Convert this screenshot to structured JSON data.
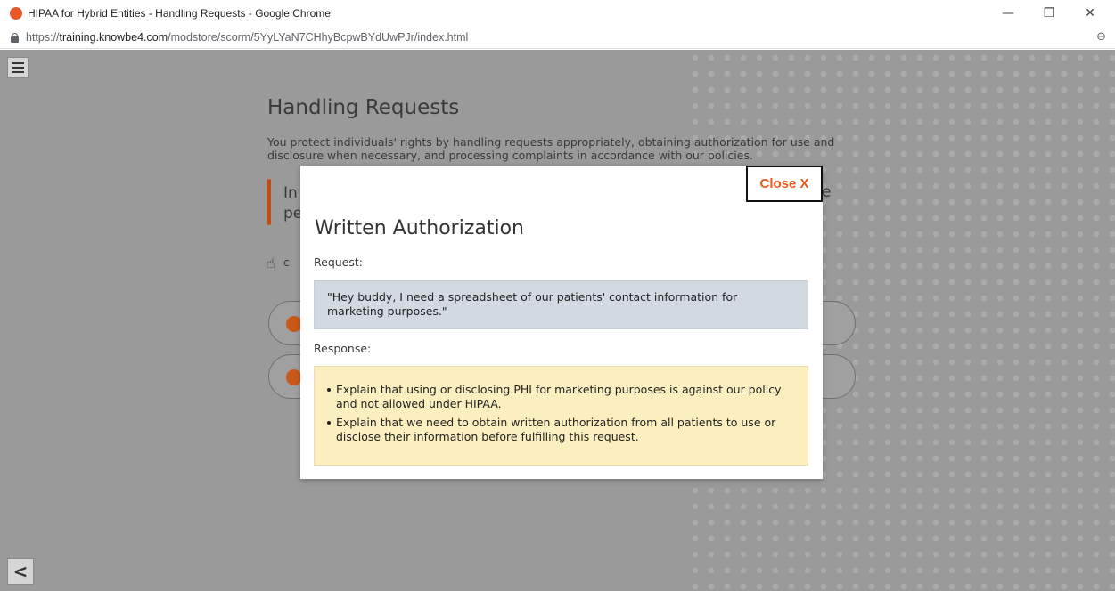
{
  "window": {
    "title": "HIPAA for Hybrid Entities - Handling Requests - Google Chrome",
    "controls": {
      "minimize": "—",
      "restore": "❐",
      "close": "✕"
    }
  },
  "address_bar": {
    "protocol": "https://",
    "host": "training.knowbe4.com",
    "path": "/modstore/scorm/5YyLYaN7CHhyBcpwBYdUwPJr/index.html",
    "zoom_icon": "⊖"
  },
  "background": {
    "heading": "Handling Requests",
    "intro": "You protect individuals' rights by handling requests appropriately, obtaining authorization for use and disclosure when necessary, and processing complaints in accordance with our policies.",
    "callout_line1": "In",
    "callout_line2": "pe",
    "callout_tail": "e",
    "hint_char": "c",
    "back_arrow": "<"
  },
  "modal": {
    "close_label": "Close X",
    "title": "Written Authorization",
    "request_label": "Request:",
    "request_text": "\"Hey buddy, I need a spreadsheet of our patients' contact information for marketing purposes.\"",
    "response_label": "Response:",
    "response_items": [
      "Explain that using or disclosing PHI for marketing purposes is against our policy and not allowed under HIPAA.",
      "Explain that we need to obtain written authorization from all patients to use or disclose their information before fulfilling this request."
    ]
  },
  "colors": {
    "accent": "#e8581b",
    "request_bg": "#d3d9e0",
    "response_bg": "#fcefbf",
    "overlay": "#9a9a9a"
  },
  "icons": {
    "favicon": "knowbe4-favicon",
    "lock": "lock-icon",
    "menu": "hamburger-icon",
    "back": "chevron-left-icon",
    "hand": "pointing-hand-icon",
    "check": "check-circle-icon"
  }
}
